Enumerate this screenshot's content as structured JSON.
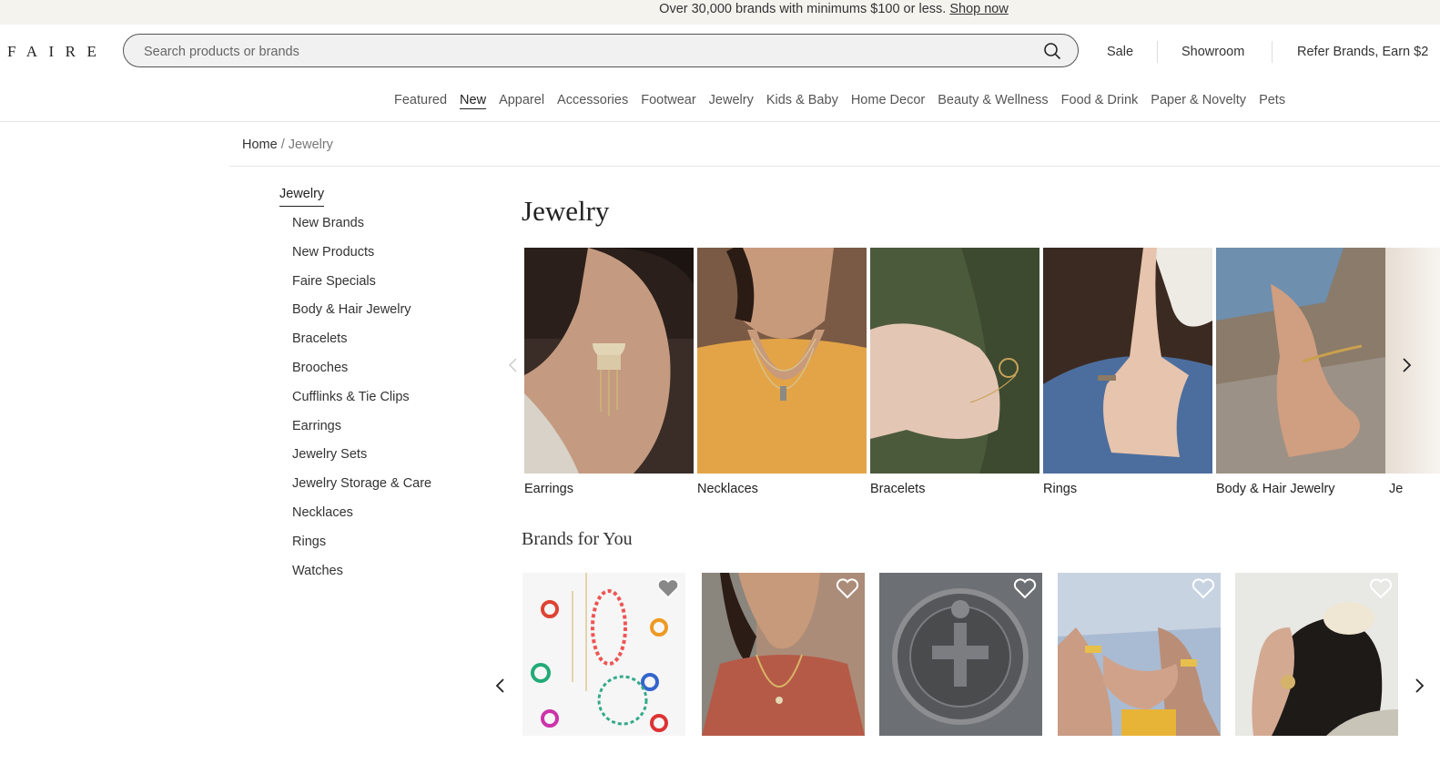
{
  "banner": {
    "text": "Over 30,000 brands with minimums $100 or less.",
    "link": "Shop now"
  },
  "logo": "FAIRE",
  "search": {
    "placeholder": "Search products or brands",
    "icon": "search-icon"
  },
  "top_links": [
    "Sale",
    "Showroom",
    "Refer Brands, Earn $2"
  ],
  "categories": [
    "Featured",
    "New",
    "Apparel",
    "Accessories",
    "Footwear",
    "Jewelry",
    "Kids & Baby",
    "Home Decor",
    "Beauty & Wellness",
    "Food & Drink",
    "Paper & Novelty",
    "Pets"
  ],
  "active_category": "New",
  "breadcrumb": {
    "home": "Home",
    "separator": " / ",
    "current": "Jewelry"
  },
  "sidebar": {
    "title": "Jewelry",
    "items": [
      "New Brands",
      "New Products",
      "Faire Specials",
      "Body & Hair Jewelry",
      "Bracelets",
      "Brooches",
      "Cufflinks & Tie Clips",
      "Earrings",
      "Jewelry Sets",
      "Jewelry Storage & Care",
      "Necklaces",
      "Rings",
      "Watches"
    ]
  },
  "main": {
    "title": "Jewelry",
    "category_tiles": [
      "Earrings",
      "Necklaces",
      "Bracelets",
      "Rings",
      "Body & Hair Jewelry",
      "Je"
    ],
    "brands_title": "Brands for You",
    "brand_icons": [
      "heart-icon",
      "chevron-left-icon",
      "chevron-right-icon"
    ]
  }
}
